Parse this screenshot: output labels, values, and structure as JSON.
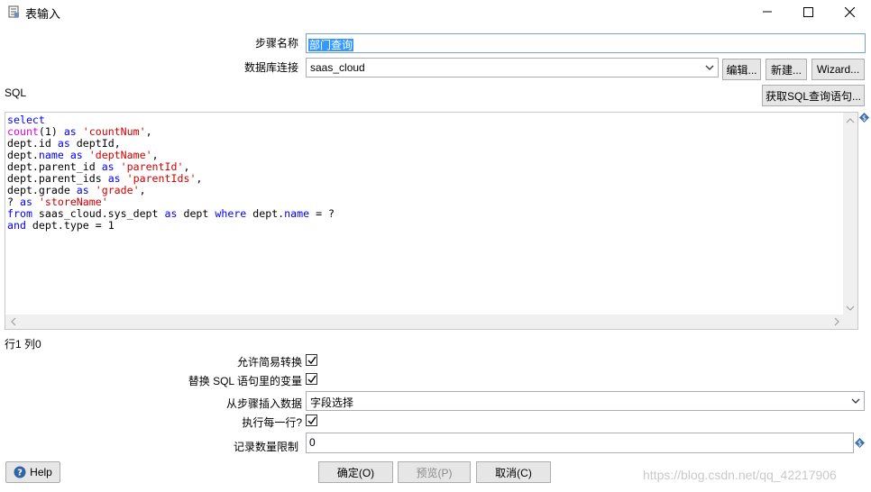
{
  "window": {
    "title": "表输入",
    "minimize_icon": "minimize-icon",
    "maximize_icon": "maximize-icon",
    "close_icon": "close-icon"
  },
  "step_name": {
    "label": "步骤名称",
    "value": "部门查询"
  },
  "db_connection": {
    "label": "数据库连接",
    "value": "saas_cloud",
    "edit_button": "编辑...",
    "new_button": "新建...",
    "wizard_button": "Wizard..."
  },
  "sql": {
    "label": "SQL",
    "get_sql_button": "获取SQL查询语句...",
    "lines": [
      "select",
      "count(1) as 'countNum',",
      "dept.id as deptId,",
      "dept.name as 'deptName',",
      "dept.parent_id as 'parentId',",
      "dept.parent_ids as 'parentIds',",
      "dept.grade as 'grade',",
      "? as 'storeName'",
      "from saas_cloud.sys_dept as dept where dept.name = ?",
      "and dept.type = 1"
    ],
    "cursor_position": "行1 列0"
  },
  "options": {
    "lazy_conversion_label": "允许简易转换",
    "lazy_conversion_checked": true,
    "replace_variables_label": "替换 SQL 语句里的变量",
    "replace_variables_checked": true,
    "insert_data_from_step_label": "从步骤插入数据",
    "insert_data_from_step_value": "字段选择",
    "execute_each_row_label": "执行每一行?",
    "execute_each_row_checked": true,
    "limit_label": "记录数量限制",
    "limit_value": "0"
  },
  "footer": {
    "help_button": "Help",
    "ok_button": "确定(O)",
    "preview_button": "预览(P)",
    "cancel_button": "取消(C)",
    "watermark": "https://blog.csdn.net/qq_42217906"
  }
}
